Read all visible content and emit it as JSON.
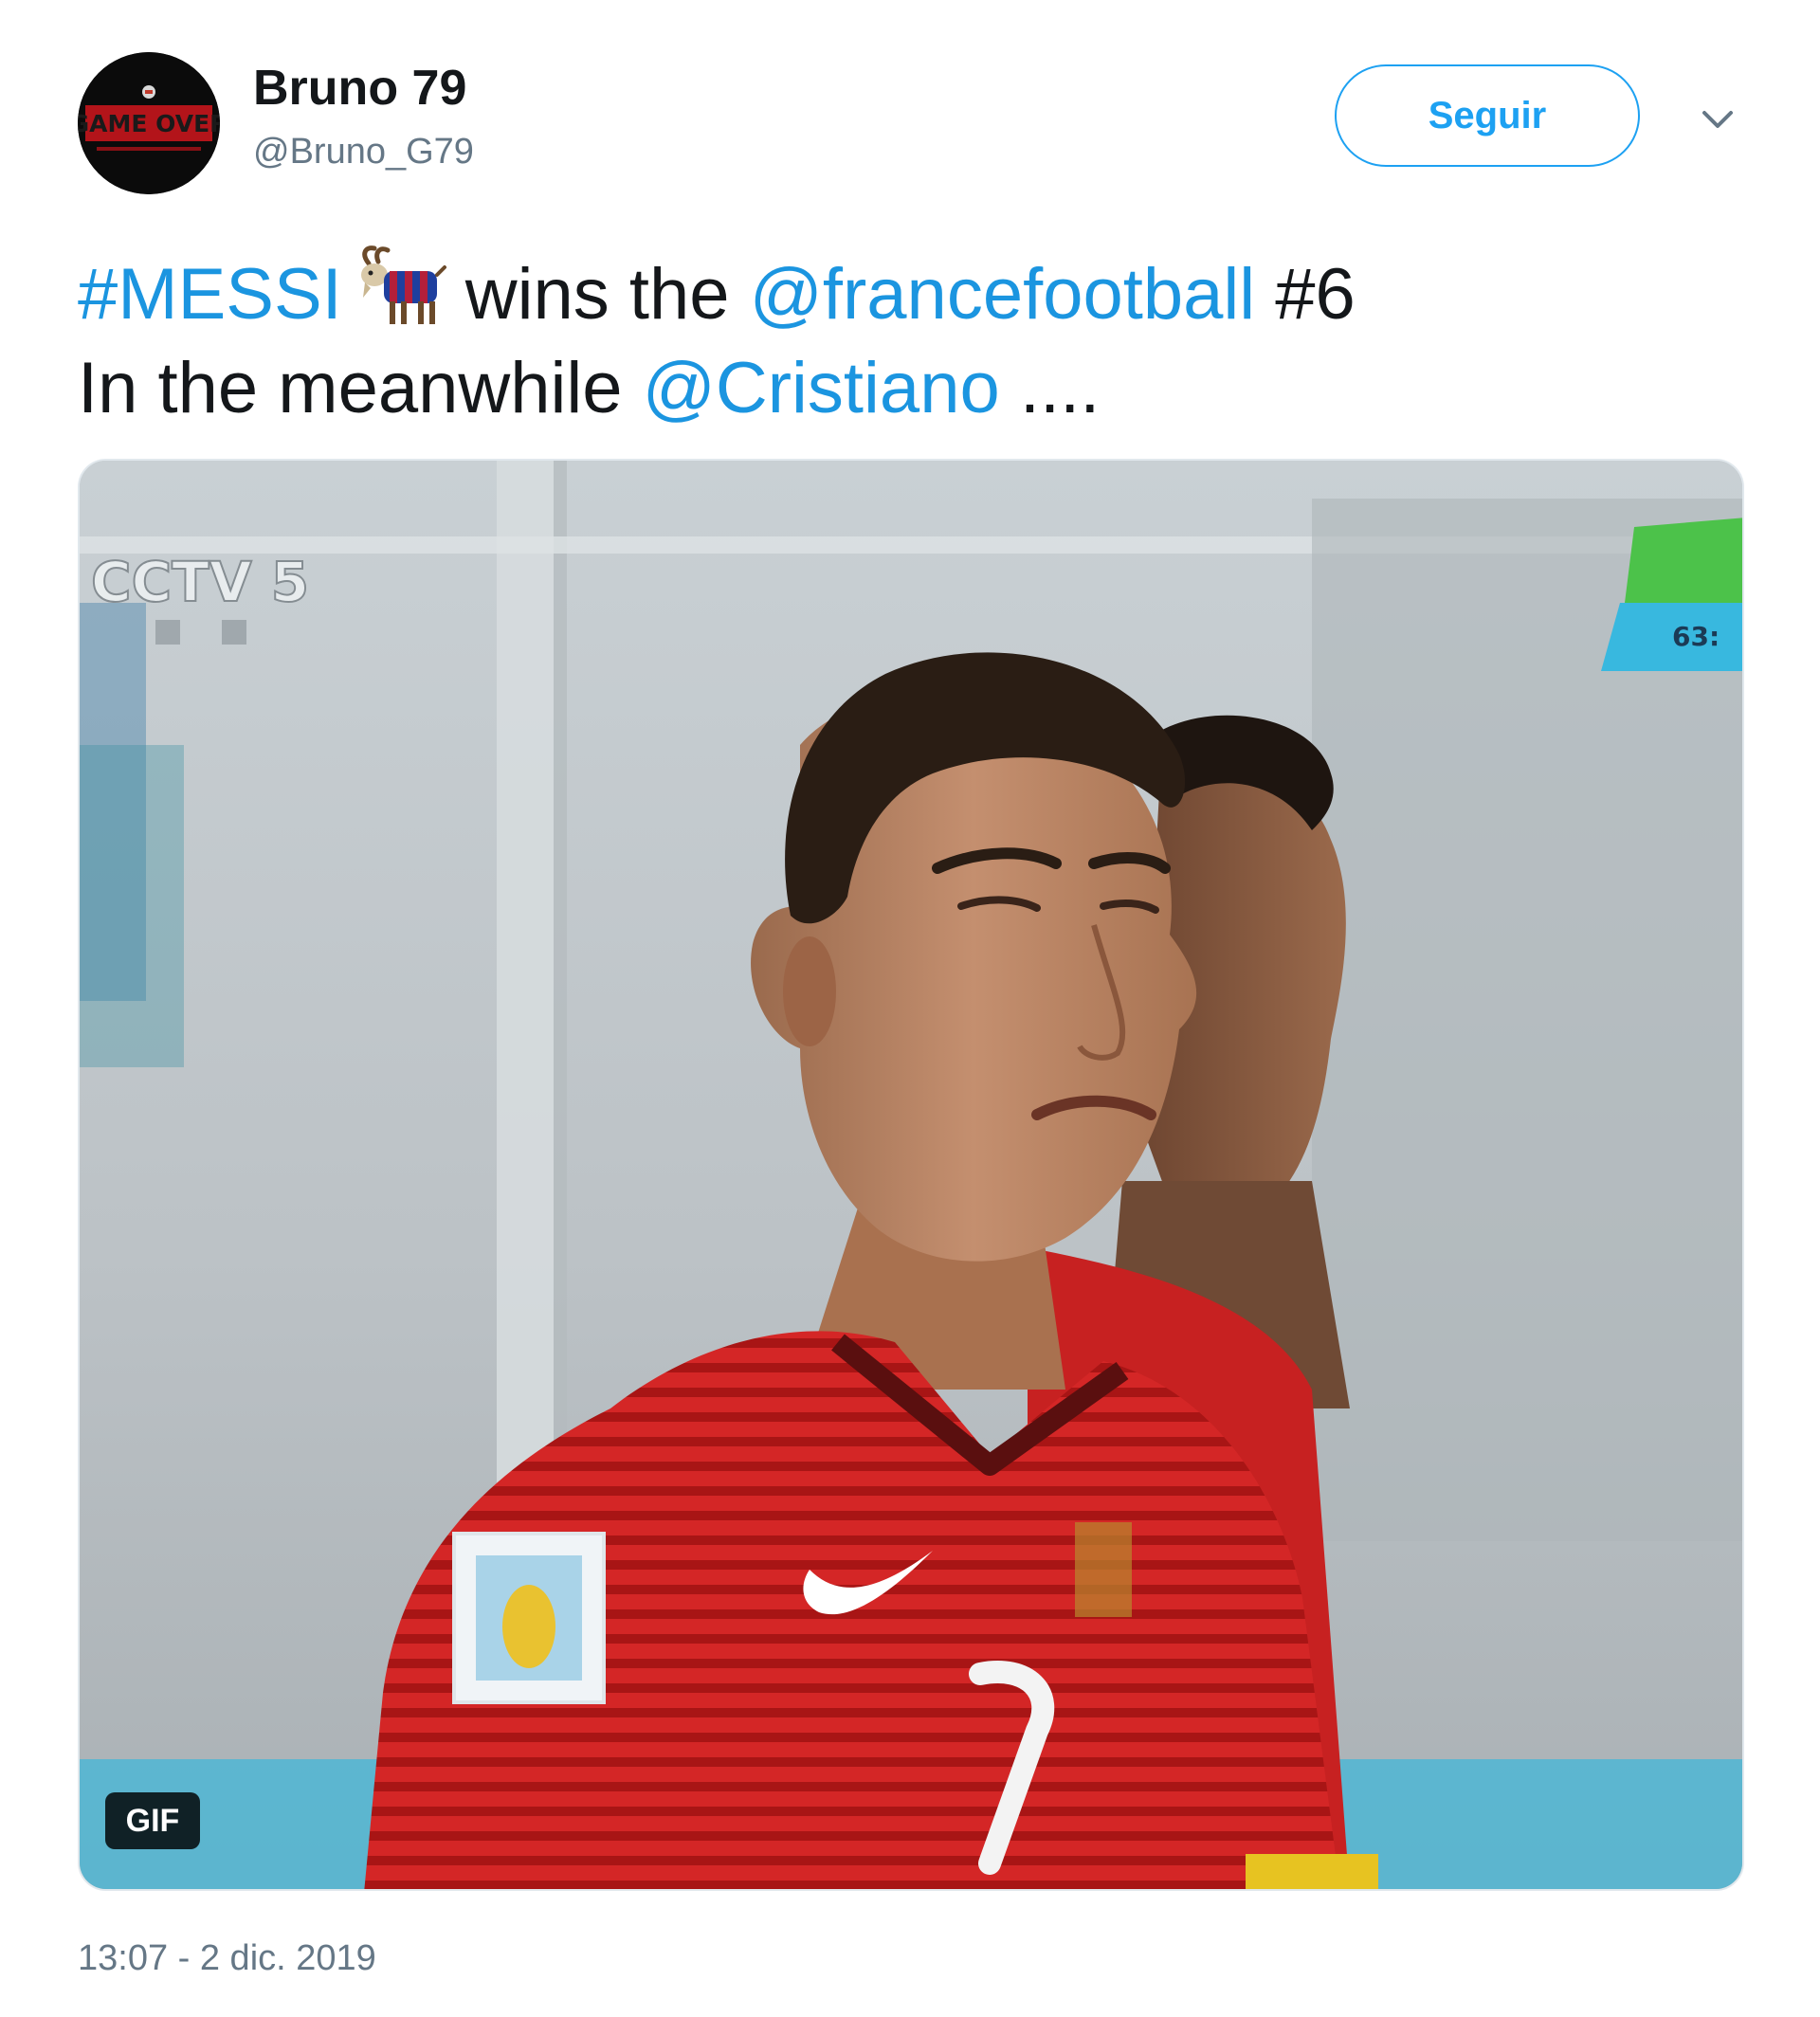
{
  "account": {
    "display_name": "Bruno 79",
    "handle": "@Bruno_G79",
    "avatar_text": "GAME OVER"
  },
  "header": {
    "follow_label": "Seguir",
    "menu_icon": "chevron-down-icon"
  },
  "tweet": {
    "line1": {
      "hashtag1": "#MESSI",
      "emoji": "goat-emoji",
      "text1": "wins the",
      "mention1": "@francefootball",
      "text2": "#6"
    },
    "line2": {
      "text1": "In the meanwhile",
      "mention1": "@Cristiano",
      "text2": "...."
    }
  },
  "media": {
    "type": "gif",
    "badge_label": "GIF",
    "broadcast_logo": "CCTV 5",
    "score_overlay": "63:"
  },
  "timestamp": "13:07 - 2 dic. 2019",
  "colors": {
    "link": "#1b95e0",
    "follow_accent": "#1da1f2",
    "secondary_text": "#657786",
    "jersey_red": "#d21f1f"
  }
}
